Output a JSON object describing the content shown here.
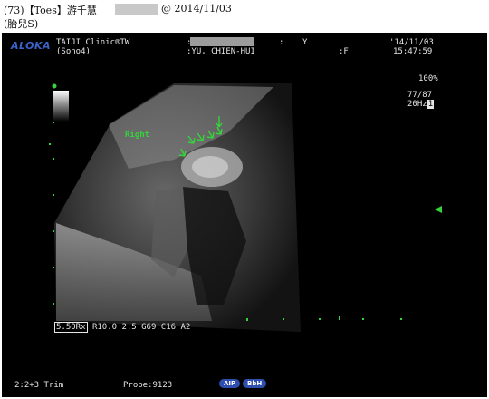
{
  "caption": {
    "line1_prefix": "(73)【Toes】游千慧",
    "line1_date": "@ 2014/11/03",
    "line2": "(胎兒S)"
  },
  "header": {
    "brand": "ALOKA",
    "clinic": "TAIJI Clinic®TW",
    "device": "(Sono4)",
    "id_colon": ":",
    "id_sep": ":",
    "id_flag": "Y",
    "name": ":YU, CHIEN-HUI",
    "sex": ":F",
    "date": "'14/11/03",
    "time": "15:47:59"
  },
  "image": {
    "label_right": "Right",
    "scale_percent": "100%",
    "gain": "77/87",
    "frame_rate": "20Hz",
    "frame_marker": "1"
  },
  "params": {
    "depth": "5.50Rx",
    "settings": "R10.0 2.5 G69 C16 A2"
  },
  "footer": {
    "mode": "2:2+3 Trim",
    "probe": "Probe:9123",
    "tag1": "AIP",
    "tag2": "BbH"
  },
  "colors": {
    "annotation_green": "#35d43a",
    "brand_blue": "#3c63c9"
  }
}
